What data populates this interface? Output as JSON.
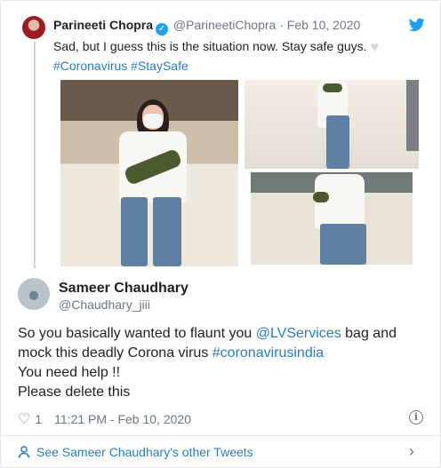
{
  "quoted_tweet": {
    "name": "Parineeti Chopra",
    "handle": "@ParineetiChopra",
    "separator": "·",
    "date": "Feb 10, 2020",
    "text": "Sad, but I guess this is the situation now. Stay safe guys.",
    "hashtags": "#Coronavirus #StaySafe",
    "photo_count": 3
  },
  "tweet": {
    "name": "Sameer Chaudhary",
    "handle": "@Chaudhary_jiii",
    "lines": {
      "l1_before": "So you basically wanted to flaunt you ",
      "l1_mention": "@LVServices",
      "l1_after": " bag and",
      "l2_before": "mock this deadly Corona virus ",
      "l2_hashtag": "#coronavirusindia",
      "l3": "You need help !!",
      "l4": "Please delete this"
    },
    "likes": "1",
    "timestamp": "11:21 PM - Feb 10, 2020"
  },
  "footer": {
    "more_link": "See Sameer Chaudhary's other Tweets"
  },
  "icons": {
    "verified": "verified-badge-icon",
    "twitter": "twitter-bird-icon",
    "like": "heart-icon",
    "info": "info-icon",
    "person": "person-icon",
    "chevron": "chevron-right-icon"
  },
  "colors": {
    "link": "#2b7bb9",
    "muted": "#697882",
    "twitter_blue": "#1da1f2"
  }
}
